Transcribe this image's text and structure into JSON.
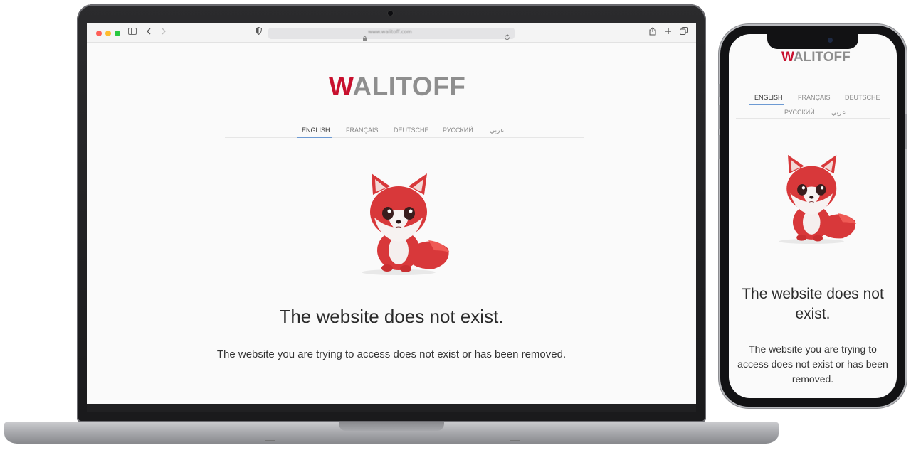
{
  "browser": {
    "url_text": "www.walitoff.com"
  },
  "site": {
    "logo_initial": "W",
    "logo_rest": "ALITOFF",
    "languages": [
      {
        "label": "ENGLISH",
        "active": true
      },
      {
        "label": "FRANÇAIS",
        "active": false
      },
      {
        "label": "DEUTSCHE",
        "active": false
      },
      {
        "label": "РУССКИЙ",
        "active": false
      },
      {
        "label": "عربي",
        "active": false
      }
    ],
    "mascot": "red-fox-illustration",
    "title": "The website does not exist.",
    "message": "The website you are trying to access does not exist or has been removed."
  },
  "colors": {
    "brand_red": "#c8102e",
    "logo_gray": "#8e8e8e",
    "active_underline": "#6d9ad3",
    "page_bg": "#fafafa"
  }
}
